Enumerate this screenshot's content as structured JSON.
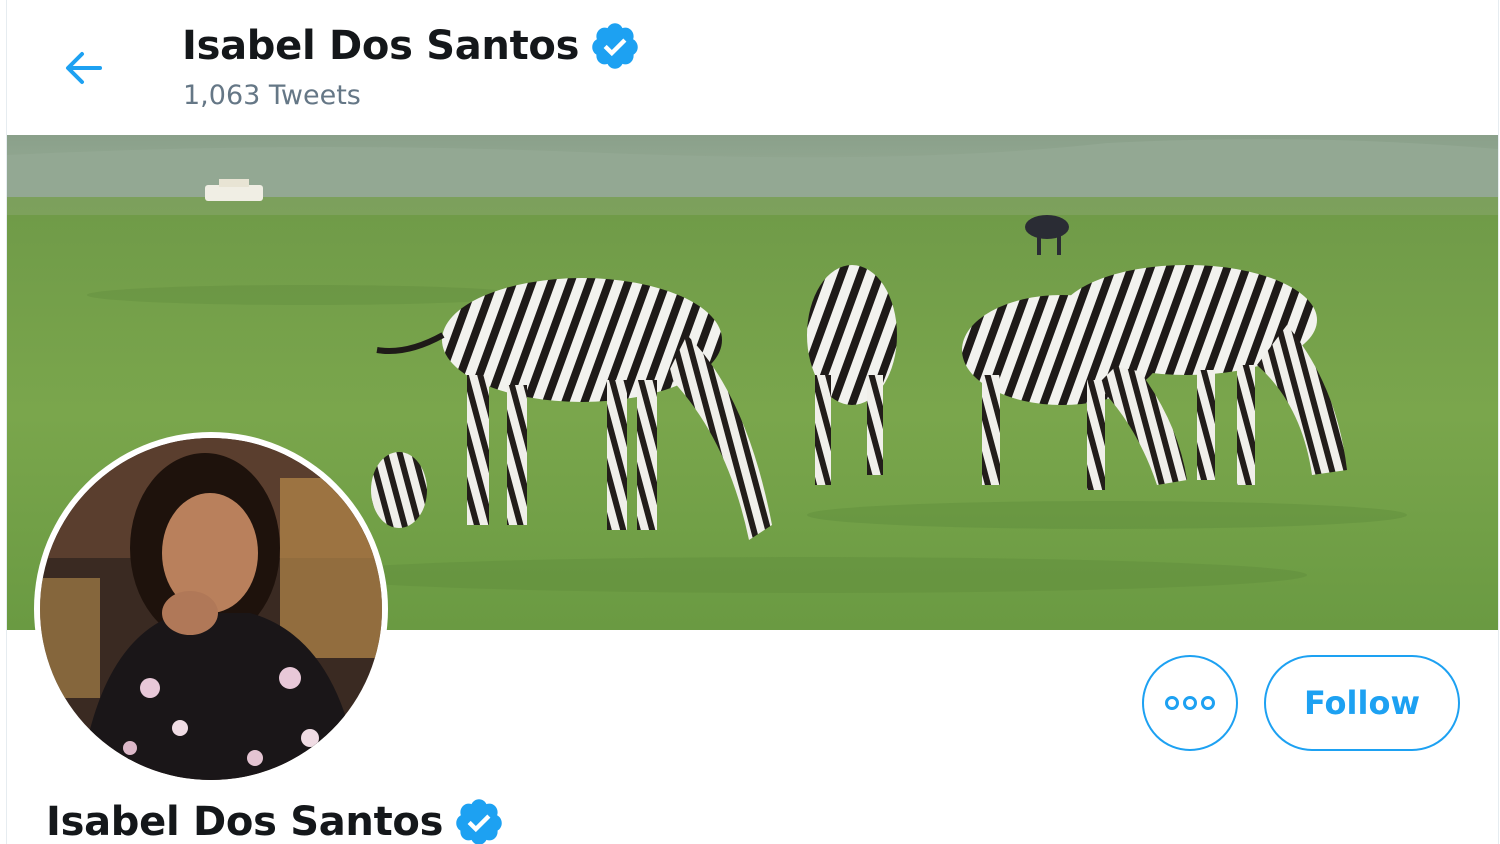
{
  "header": {
    "back_icon": "arrow-left-icon",
    "name": "Isabel Dos Santos",
    "verified_icon": "verified-badge-icon",
    "tweet_count": "1,063 Tweets"
  },
  "banner": {
    "description_icon": "banner-image"
  },
  "profile": {
    "avatar_icon": "avatar",
    "more_icon": "more-dots-icon",
    "follow_label": "Follow",
    "name": "Isabel Dos Santos"
  },
  "colors": {
    "accent": "#1da1f2",
    "text_primary": "#14171a",
    "text_secondary": "#657786"
  }
}
